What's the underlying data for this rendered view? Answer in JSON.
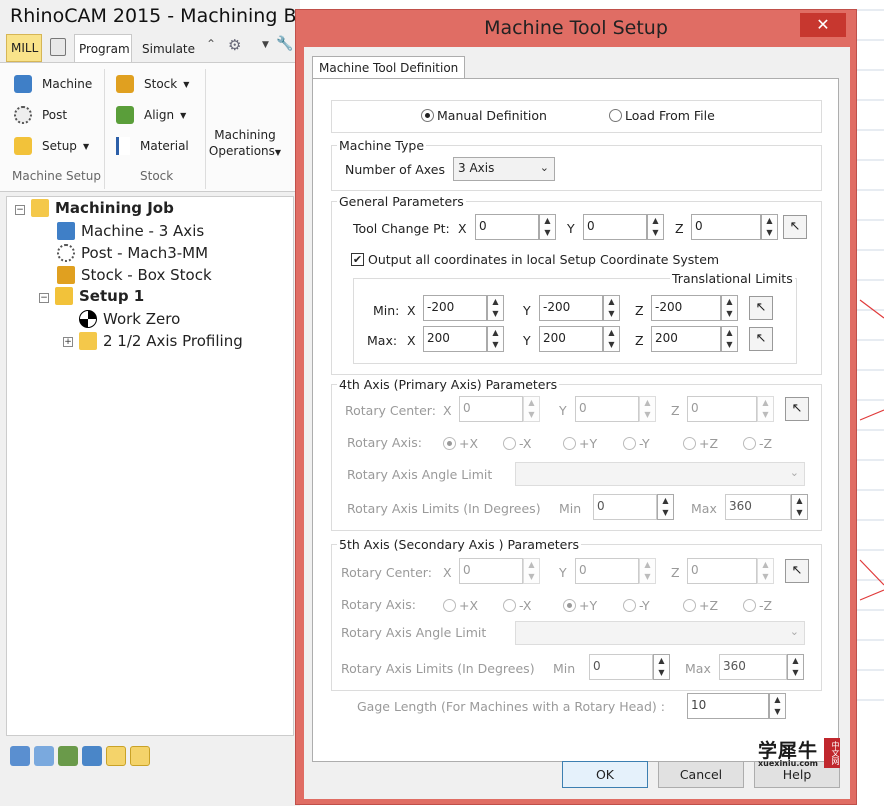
{
  "app": {
    "title": "RhinoCAM 2015 - Machining B",
    "tabs": {
      "mill": "MILL",
      "program": "Program",
      "simulate": "Simulate"
    },
    "ribbon": {
      "machine": "Machine",
      "post": "Post",
      "setup": "Setup",
      "stock": "Stock",
      "align": "Align",
      "material": "Material",
      "machining": "Machining",
      "operations": "Operations",
      "group_machine_setup": "Machine Setup",
      "group_stock": "Stock"
    },
    "tree": {
      "root": "Machining Job",
      "machine": "Machine - 3 Axis",
      "post": "Post - Mach3-MM",
      "stock": "Stock - Box Stock",
      "setup": "Setup 1",
      "work_zero": "Work Zero",
      "profiling": "2 1/2 Axis Profiling"
    }
  },
  "dialog": {
    "title": "Machine Tool Setup",
    "close": "✕",
    "tab": "Machine Tool Definition",
    "manual": "Manual Definition",
    "load": "Load From File",
    "machine_type": {
      "label": "Machine Type",
      "num_axes_label": "Number of Axes",
      "num_axes": "3 Axis"
    },
    "general": {
      "label": "General Parameters",
      "tcp_label": "Tool Change Pt:",
      "tcp": {
        "x": "0",
        "y": "0",
        "z": "0"
      },
      "output_local": "Output all coordinates in local Setup Coordinate System",
      "trans_limits": "Translational Limits",
      "min_label": "Min:",
      "max_label": "Max:",
      "min": {
        "x": "-200",
        "y": "-200",
        "z": "-200"
      },
      "max": {
        "x": "200",
        "y": "200",
        "z": "200"
      }
    },
    "axis4": {
      "label": "4th Axis (Primary Axis) Parameters",
      "center_label": "Rotary Center:",
      "center": {
        "x": "0",
        "y": "0",
        "z": "0"
      },
      "axis_label": "Rotary Axis:",
      "options": [
        "+X",
        "-X",
        "+Y",
        "-Y",
        "+Z",
        "-Z"
      ],
      "selected": 0,
      "angle_limit_label": "Rotary Axis Angle Limit",
      "limits_label": "Rotary Axis Limits (In Degrees)",
      "min_label": "Min",
      "min": "0",
      "max_label": "Max",
      "max": "360"
    },
    "axis5": {
      "label": "5th Axis (Secondary Axis ) Parameters",
      "center_label": "Rotary Center:",
      "center": {
        "x": "0",
        "y": "0",
        "z": "0"
      },
      "axis_label": "Rotary Axis:",
      "options": [
        "+X",
        "-X",
        "+Y",
        "-Y",
        "+Z",
        "-Z"
      ],
      "selected": 2,
      "angle_limit_label": "Rotary Axis Angle Limit",
      "limits_label": "Rotary Axis Limits (In Degrees)",
      "min_label": "Min",
      "min": "0",
      "max_label": "Max",
      "max": "360"
    },
    "gage_label": "Gage Length (For Machines with a Rotary Head) :",
    "gage": "10",
    "buttons": {
      "ok": "OK",
      "cancel": "Cancel",
      "help": "Help"
    }
  },
  "axis_letters": {
    "x": "X",
    "y": "Y",
    "z": "Z"
  },
  "watermark": {
    "main": "学犀牛",
    "badge": "中文网",
    "url": "xuexiniu.com"
  },
  "colors": {
    "dialog_frame": "#e06d64",
    "close": "#c7372f",
    "cad_lines": "#e03a3a"
  }
}
